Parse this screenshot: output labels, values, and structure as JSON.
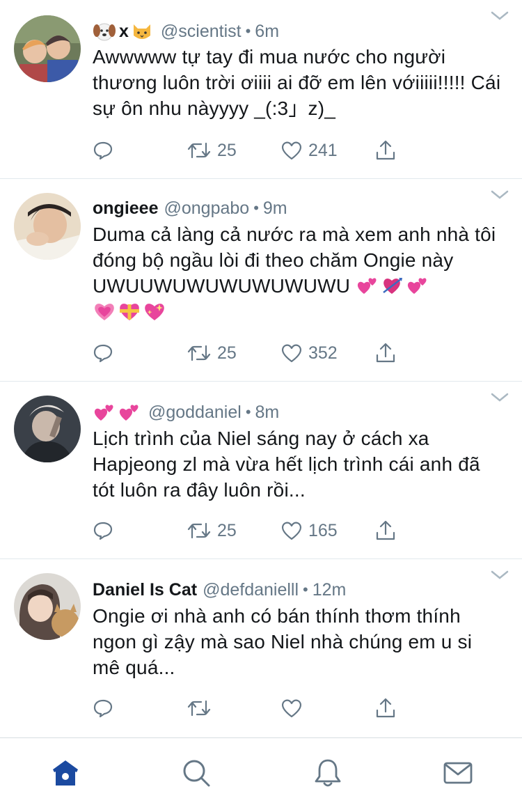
{
  "tweets": [
    {
      "name": "",
      "name_emoji": [
        "dog-face",
        "x",
        "cat-face"
      ],
      "handle": "@scientist",
      "time": "6m",
      "text": "Awwwww tự tay đi mua nước cho người thương luôn trời ơiiii ai đỡ em lên vớiiiii!!!!! Cái sự ôn nhu nàyyyy _(:3」z)_",
      "reply_count": "",
      "retweet_count": "25",
      "like_count": "241"
    },
    {
      "name": "ongieee",
      "handle": "@ongpabo",
      "time": "9m",
      "text": "Duma cả làng cả nước ra mà xem anh nhà tôi đóng bộ ngầu lòi đi theo chăm Ongie này UWUUWUWUWUWUWUWU",
      "text_emojis": [
        "two-hearts",
        "heart-with-arrow",
        "two-hearts",
        "growing-heart",
        "heart-with-ribbon",
        "sparkling-heart"
      ],
      "reply_count": "",
      "retweet_count": "25",
      "like_count": "352"
    },
    {
      "name": "",
      "name_emoji": [
        "two-hearts",
        "two-hearts"
      ],
      "handle": "@goddaniel",
      "time": "8m",
      "text": "Lịch trình của Niel sáng nay ở cách xa Hapjeong zl mà vừa hết lịch trình cái anh đã tót luôn ra đây luôn rồi...",
      "reply_count": "",
      "retweet_count": "25",
      "like_count": "165"
    },
    {
      "name": "Daniel Is Cat",
      "handle": "@defdanielll",
      "time": "12m",
      "text": "Ongie ơi nhà anh có bán thính thơm thính ngon gì zậy mà sao Niel nhà chúng em u si mê quá...",
      "reply_count": "",
      "retweet_count": "",
      "like_count": ""
    }
  ],
  "tabbar": {
    "active": "home",
    "accent_color": "#1b4aa0",
    "icons": [
      "home-icon",
      "search-icon",
      "notifications-icon",
      "messages-icon"
    ]
  },
  "colors": {
    "text": "#14171a",
    "muted": "#657786",
    "divider": "#e1e8ed",
    "heart_pink": "#e8459c"
  }
}
